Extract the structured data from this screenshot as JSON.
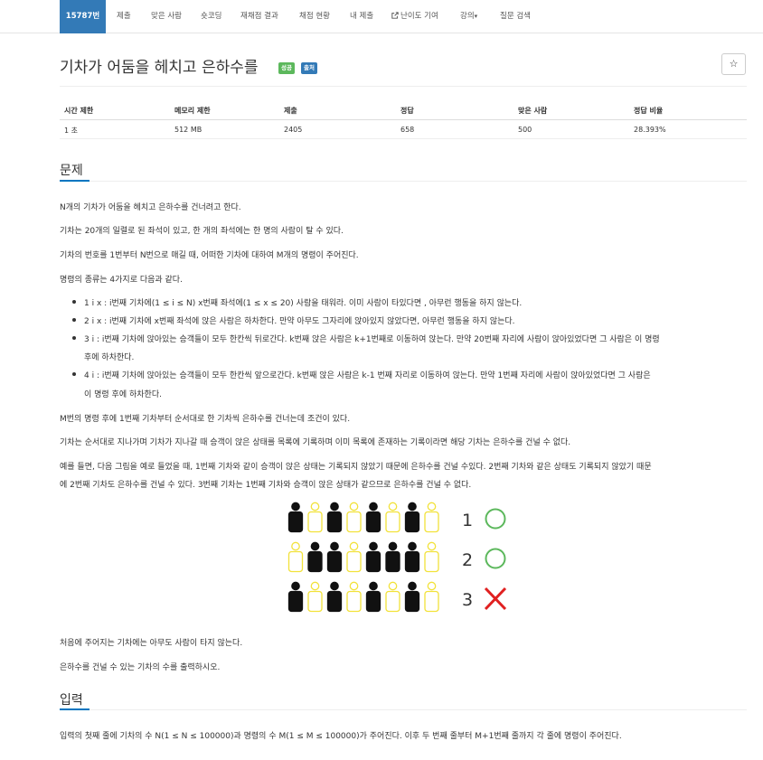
{
  "nav": {
    "problem_number": "15787번",
    "items": [
      "제출",
      "맞은 사람",
      "숏코딩",
      "재채점 결과",
      "채점 현황",
      "내 제출",
      "난이도 기여",
      "강의",
      "질문 검색"
    ],
    "dropdown_caret": "▾"
  },
  "title": "기차가 어둠을 헤치고 은하수를",
  "badges": {
    "success": "성공",
    "multilang": "출처"
  },
  "star": "☆",
  "stats": {
    "headers": [
      "시간 제한",
      "메모리 제한",
      "제출",
      "정답",
      "맞은 사람",
      "정답 비율"
    ],
    "values": [
      "1 초",
      "512 MB",
      "2405",
      "658",
      "500",
      "28.393%"
    ]
  },
  "sections": {
    "problem": "문제",
    "input": "입력"
  },
  "problem": {
    "p1": "N개의 기차가 어둠을 헤치고 은하수를 건너려고 한다.",
    "p2": "기차는 20개의 일렬로 된 좌석이 있고, 한 개의 좌석에는 한 명의 사람이 탈 수 있다.",
    "p3": "기차의 번호를 1번부터 N번으로 매길 때, 어떠한 기차에 대하여 M개의 명령이 주어진다.",
    "p4": "명령의 종류는 4가지로 다음과 같다.",
    "list": [
      "1 i x : i번째 기차에(1 ≤ i ≤ N) x번째 좌석에(1 ≤ x ≤ 20) 사람을 태워라. 이미 사람이 타있다면 , 아무런 행동을 하지 않는다.",
      "2 i x : i번째 기차에 x번째 좌석에 앉은 사람은 하차한다. 만약 아무도 그자리에 앉아있지 않았다면, 아무런 행동을 하지 않는다.",
      "3 i : i번째 기차에 앉아있는 승객들이 모두 한칸씩 뒤로간다. k번째 앉은 사람은 k+1번째로 이동하여 앉는다. 만약 20번째 자리에 사람이 앉아있었다면 그 사람은 이 명령",
      "후에 하차한다.",
      "4 i : i번째 기차에 앉아있는 승객들이 모두 한칸씩 앞으로간다. k번째 앉은 사람은 k-1 번째 자리로 이동하여 앉는다. 만약 1번째 자리에 사람이 앉아있었다면 그 사람은",
      "이 명령 후에 하차한다."
    ],
    "p5": "M번의 명령 후에 1번째 기차부터 순서대로 한 기차씩 은하수를 건너는데 조건이 있다.",
    "p6": "기차는 순서대로 지나가며 기차가 지나갈 때 승객이 앉은 상태를 목록에 기록하며 이미 목록에 존재하는 기록이라면 해당 기차는 은하수를 건널 수 없다.",
    "p7": "예를 들면, 다음 그림을 예로 들었을 때, 1번째 기차와 같이 승객이 앉은 상태는 기록되지 않았기 때문에 은하수를 건널 수있다. 2번째 기차와 같은 상태도 기록되지 않았기 때문",
    "p8": "에 2번째 기차도 은하수를 건널 수 있다. 3번째 기차는 1번째 기차와 승객이 앉은 상태가 같으므로 은하수를 건널 수 없다.",
    "p9": "처음에 주어지는 기차에는 아무도 사람이 타지 않는다.",
    "p10": "은하수를 건널 수 있는 기차의 수를 출력하시오."
  },
  "figure": {
    "rows": [
      {
        "label": "1",
        "seats": [
          1,
          0,
          1,
          0,
          1,
          0,
          1,
          0
        ],
        "result": "pass"
      },
      {
        "label": "2",
        "seats": [
          0,
          1,
          1,
          0,
          1,
          1,
          1,
          0
        ],
        "result": "pass"
      },
      {
        "label": "3",
        "seats": [
          1,
          0,
          1,
          0,
          1,
          0,
          1,
          0
        ],
        "result": "fail"
      }
    ],
    "colors": {
      "filled": "#111111",
      "empty_outline": "#f2e23a",
      "pass": "#5cb85c",
      "fail": "#e02020"
    }
  },
  "input": {
    "p1": "입력의 첫째 줄에 기차의 수 N(1 ≤ N ≤ 100000)과 명령의 수 M(1 ≤ M ≤ 100000)가 주어진다. 이후 두 번째 줄부터 M+1번째 줄까지 각 줄에 명령이 주어진다."
  }
}
